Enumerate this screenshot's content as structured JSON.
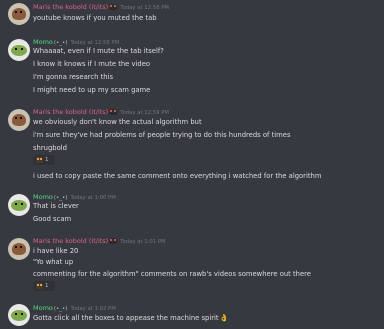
{
  "colors": {
    "background": "#36393f",
    "maris": "#e0658a",
    "momo": "#57d98a",
    "text": "#dcddde",
    "timestamp": "#72767d"
  },
  "messages": [
    {
      "author": "Maris the kobold (it/its)",
      "author_color": "maris",
      "time": "Today at 12:58 PM",
      "lines": [
        "youtube knows if you muted the tab"
      ]
    },
    {
      "author": "Momo",
      "author_badge": "(•_•)",
      "author_color": "momo",
      "time": "Today at 12:58 PM",
      "lines": [
        "Whaaaat, even if I mute the tab itself?",
        "I know it knows if I mute the video",
        "I'm gonna research this",
        "I might need to up my scam game"
      ]
    },
    {
      "author": "Maris the kobold (it/its)",
      "author_color": "maris",
      "time": "Today at 12:59 PM",
      "lines": [
        "we obviously don't know the actual algorithm but",
        "i'm sure they've had problems of people trying to do this hundreds of times",
        "shrugbold"
      ],
      "reaction": {
        "emoji": "shrugbold-emoji",
        "count": "1"
      },
      "after_reaction": [
        "i used to copy paste the same comment onto everything i watched for the algorithm"
      ]
    },
    {
      "author": "Momo",
      "author_badge": "(•_•)",
      "author_color": "momo",
      "time": "Today at 1:00 PM",
      "lines": [
        "That is clever",
        "Good scam"
      ]
    },
    {
      "author": "Maris the kobold (it/its)",
      "author_color": "maris",
      "time": "Today at 1:01 PM",
      "lines": [
        "i have like 20",
        "\"Yo what up",
        "commenting for the algorithm\" comments on rawb's videos somewhere out there"
      ],
      "reaction": {
        "emoji": "kobold-emoji",
        "count": "1"
      }
    },
    {
      "author": "Momo",
      "author_badge": "(•_•)",
      "author_color": "momo",
      "time": "Today at 1:02 PM",
      "lines": [
        "Gotta click all the boxes to appease the machine spirit"
      ],
      "trailing_emoji": "ok-hand-emoji"
    }
  ]
}
